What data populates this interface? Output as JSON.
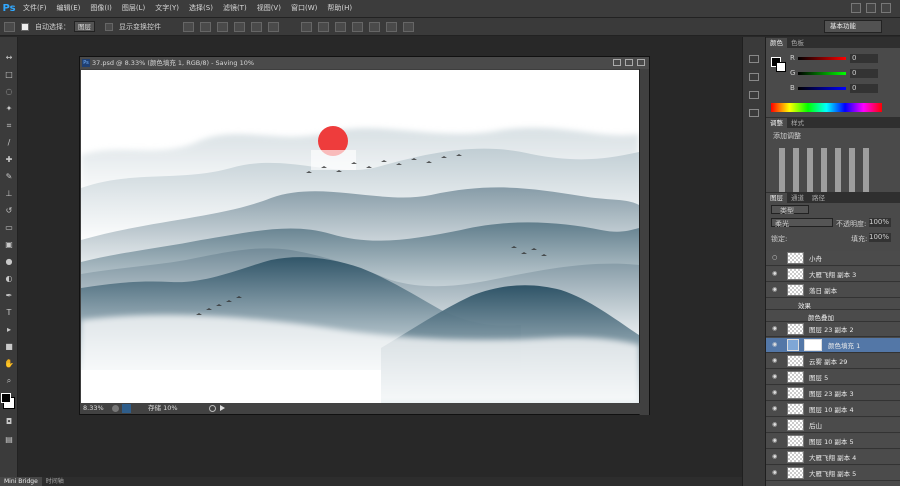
{
  "app": {
    "logo": "Ps"
  },
  "menu": [
    "文件(F)",
    "编辑(E)",
    "图像(I)",
    "图层(L)",
    "文字(Y)",
    "选择(S)",
    "滤镜(T)",
    "视图(V)",
    "窗口(W)",
    "帮助(H)"
  ],
  "options": {
    "auto_select": "自动选择：",
    "auto_select_value": "图层",
    "show_transform": "显示变换控件",
    "workspace": "基本功能"
  },
  "document": {
    "title": "37.psd @ 8.33% (颜色填充 1, RGB/8) - Saving 10%",
    "zoom": "8.33%",
    "status": "存储 10%"
  },
  "color_panel": {
    "tabs": [
      "颜色",
      "色板"
    ],
    "labels": [
      "R",
      "G",
      "B"
    ],
    "values": [
      "0",
      "0",
      "0"
    ]
  },
  "adjust_panel": {
    "tabs": [
      "调整",
      "样式"
    ],
    "title": "添加调整"
  },
  "layers_panel": {
    "tabs": [
      "图层",
      "通道",
      "路径"
    ],
    "kind": "类型",
    "blend": "柔光",
    "opacity_label": "不透明度:",
    "opacity": "100%",
    "lock_label": "锁定:",
    "fill_label": "填充:",
    "fill": "100%",
    "layers": [
      {
        "name": "小舟"
      },
      {
        "name": "大雁飞翔 副本 3"
      },
      {
        "name": "落日 副本"
      },
      {
        "name": "效果"
      },
      {
        "name": "颜色叠加"
      },
      {
        "name": "图层 23 副本 2"
      },
      {
        "name": "颜色填充 1"
      },
      {
        "name": "云雾 副本 29"
      },
      {
        "name": "图层 5"
      },
      {
        "name": "图层 23 副本 3"
      },
      {
        "name": "图层 10 副本 4"
      },
      {
        "name": "后山"
      },
      {
        "name": "图层 10 副本 5"
      },
      {
        "name": "大雁飞翔 副本 4"
      },
      {
        "name": "大雁飞翔 副本 5"
      }
    ]
  },
  "bottom_tabs": [
    "Mini Bridge",
    "时间轴"
  ]
}
